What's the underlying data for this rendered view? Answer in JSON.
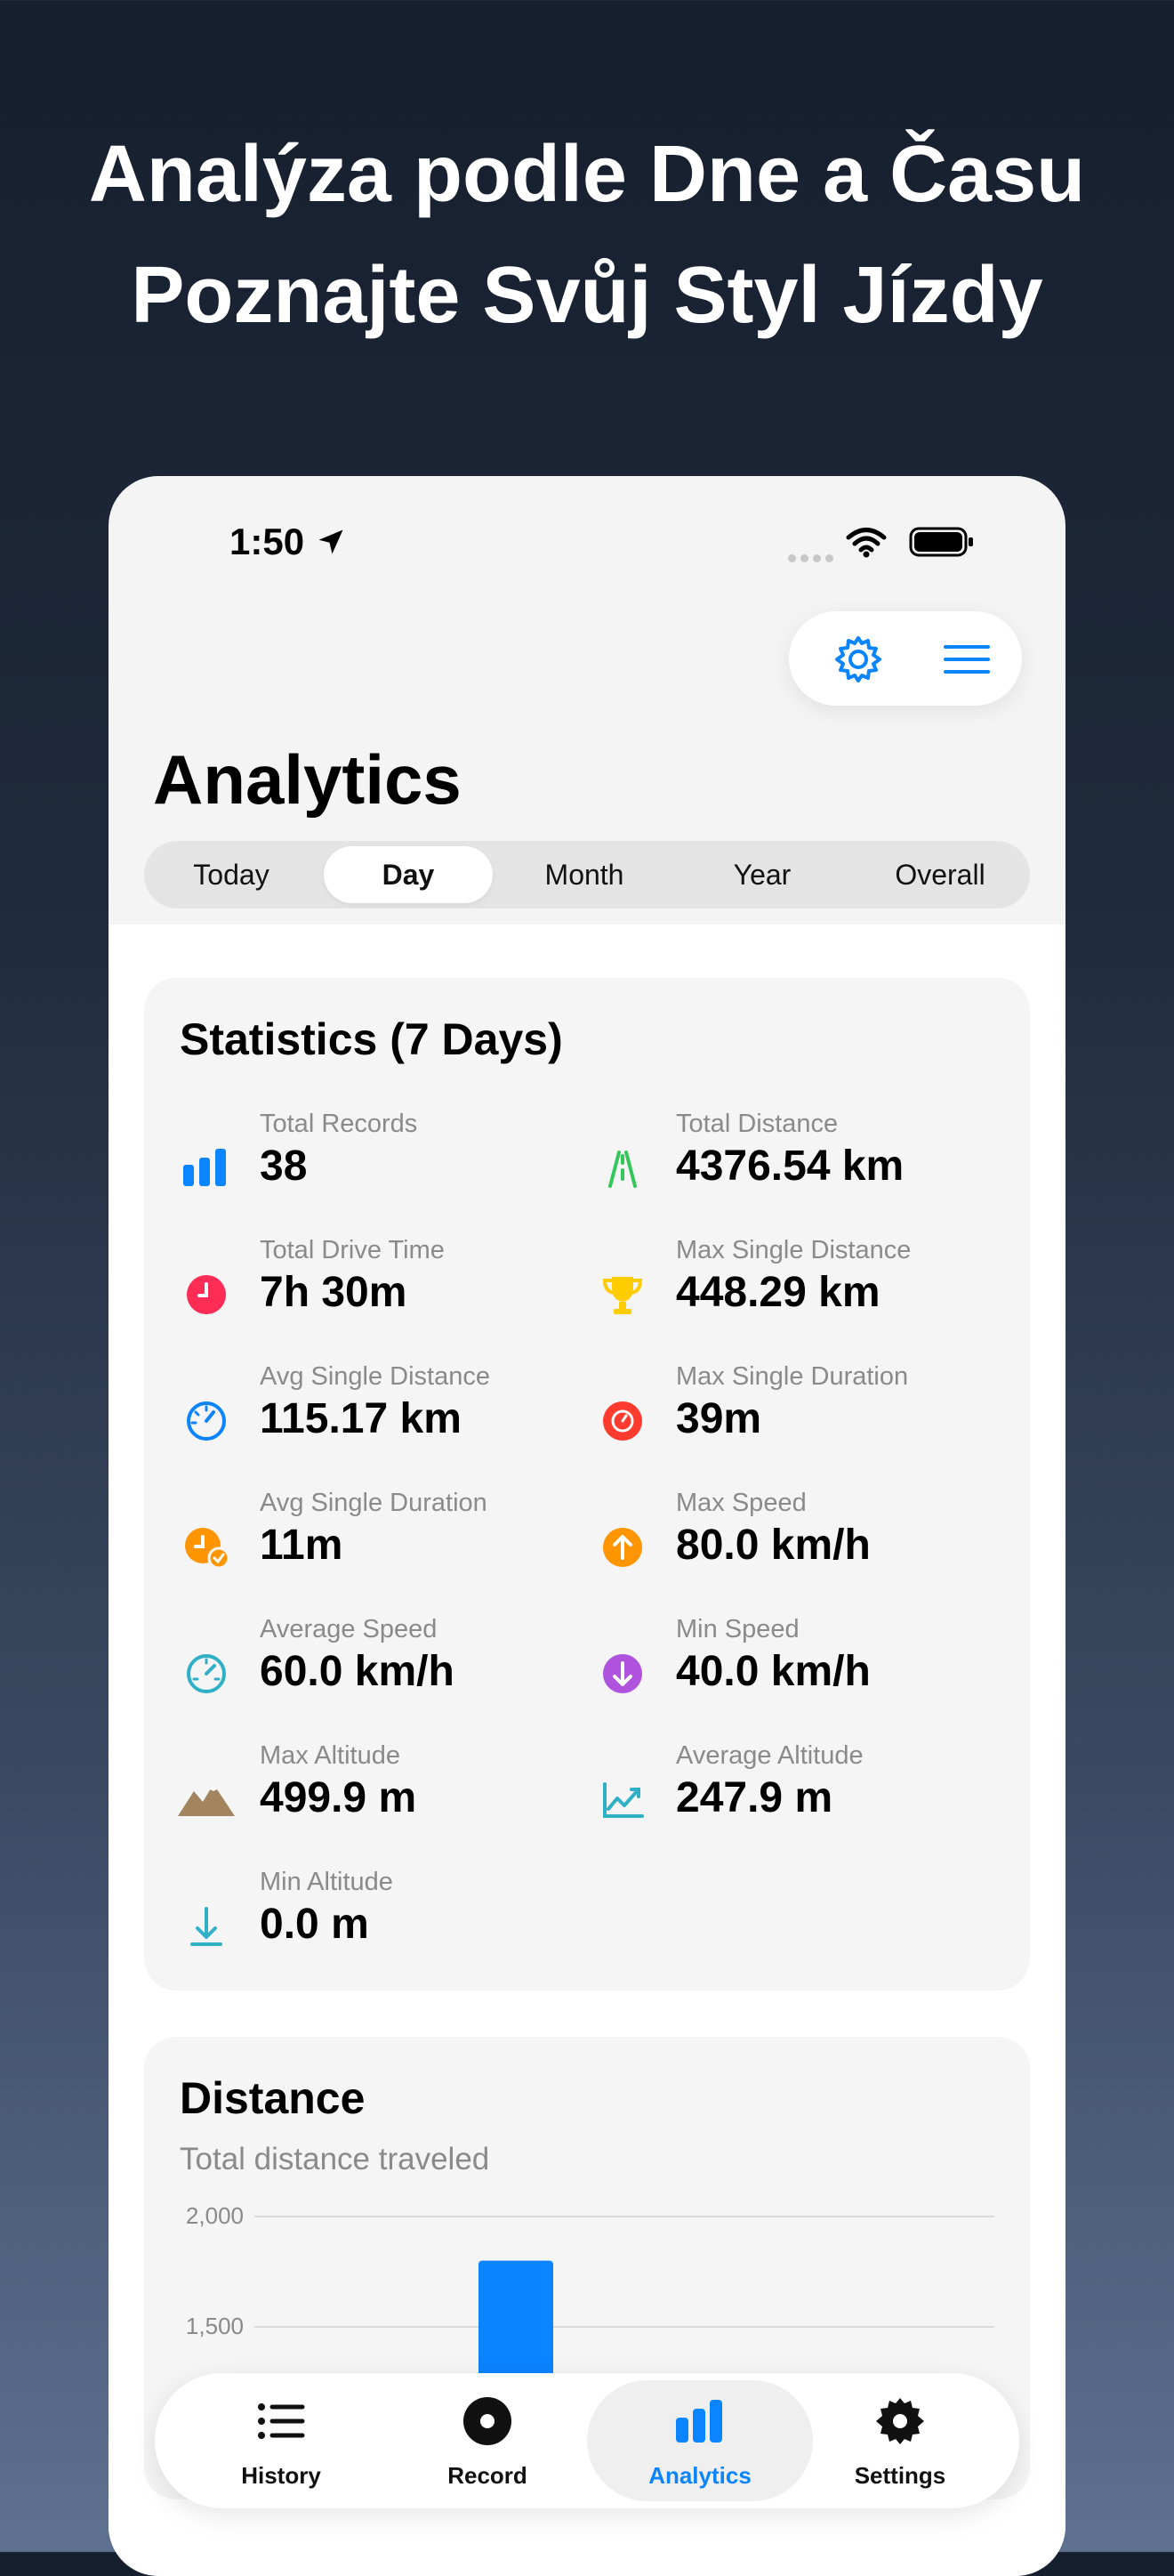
{
  "headline": {
    "line1": "Analýza podle Dne a Času",
    "line2": "Poznajte Svůj Styl Jízdy"
  },
  "status_bar": {
    "time": "1:50"
  },
  "page": {
    "title": "Analytics"
  },
  "segments": [
    {
      "label": "Today",
      "active": false
    },
    {
      "label": "Day",
      "active": true
    },
    {
      "label": "Month",
      "active": false
    },
    {
      "label": "Year",
      "active": false
    },
    {
      "label": "Overall",
      "active": false
    }
  ],
  "statistics": {
    "title": "Statistics (7 Days)",
    "items": [
      {
        "label": "Total Records",
        "value": "38",
        "icon": "bar-chart-icon",
        "color": "#0b84ff"
      },
      {
        "label": "Total Distance",
        "value": "4376.54 km",
        "icon": "road-icon",
        "color": "#34c759"
      },
      {
        "label": "Total Drive Time",
        "value": "7h 30m",
        "icon": "clock-icon",
        "color": "#ff2d55"
      },
      {
        "label": "Max Single Distance",
        "value": "448.29 km",
        "icon": "trophy-icon",
        "color": "#ffcc00"
      },
      {
        "label": "Avg Single Distance",
        "value": "115.17 km",
        "icon": "gauge-icon",
        "color": "#0b84ff"
      },
      {
        "label": "Max Single Duration",
        "value": "39m",
        "icon": "timer-icon",
        "color": "#ff3b30"
      },
      {
        "label": "Avg Single Duration",
        "value": "11m",
        "icon": "clock-check-icon",
        "color": "#ff9500"
      },
      {
        "label": "Max Speed",
        "value": "80.0 km/h",
        "icon": "arrow-up-circle-icon",
        "color": "#ff9500"
      },
      {
        "label": "Average Speed",
        "value": "60.0 km/h",
        "icon": "speedometer-icon",
        "color": "#30b0c7"
      },
      {
        "label": "Min Speed",
        "value": "40.0 km/h",
        "icon": "arrow-down-circle-icon",
        "color": "#af52de"
      },
      {
        "label": "Max Altitude",
        "value": "499.9 m",
        "icon": "mountain-icon",
        "color": "#a2845e"
      },
      {
        "label": "Average Altitude",
        "value": "247.9 m",
        "icon": "trend-chart-icon",
        "color": "#30b0c7"
      },
      {
        "label": "Min Altitude",
        "value": "0.0 m",
        "icon": "arrow-down-to-line-icon",
        "color": "#30b0c7"
      }
    ]
  },
  "distance_card": {
    "title": "Distance",
    "subtitle": "Total distance traveled"
  },
  "chart_data": {
    "type": "bar",
    "title": "Distance",
    "subtitle": "Total distance traveled",
    "y_ticks": [
      "2,000",
      "1,500"
    ],
    "ylim": [
      0,
      2000
    ],
    "values": [
      1800
    ],
    "bar_color": "#0b84ff",
    "grid": true
  },
  "tabbar": [
    {
      "label": "History",
      "icon": "list-icon",
      "active": false
    },
    {
      "label": "Record",
      "icon": "record-icon",
      "active": false
    },
    {
      "label": "Analytics",
      "icon": "bar-chart-icon",
      "active": true
    },
    {
      "label": "Settings",
      "icon": "gear-icon",
      "active": false
    }
  ],
  "colors": {
    "accent": "#0b84ff"
  }
}
